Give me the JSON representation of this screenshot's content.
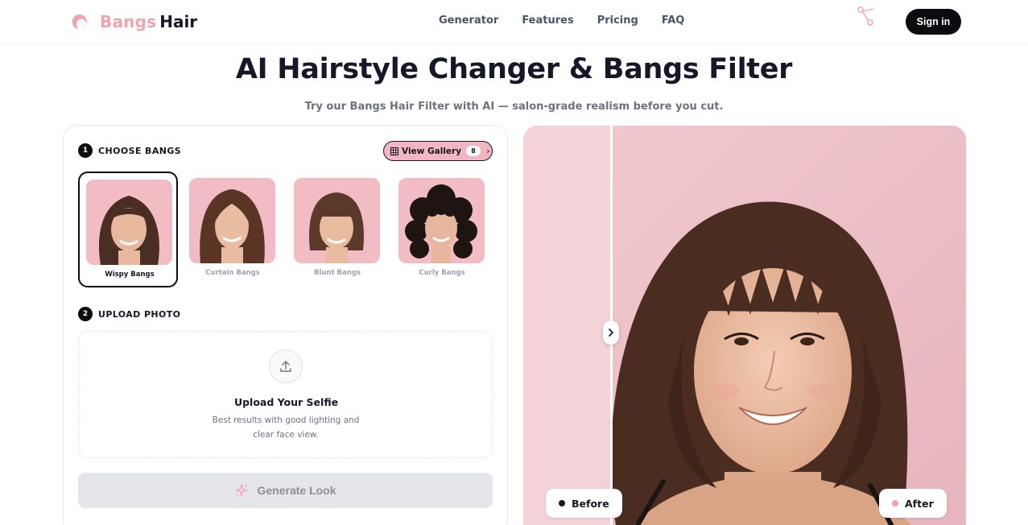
{
  "header": {
    "brand_part1": "Bangs",
    "brand_part2": "Hair",
    "nav": [
      "Generator",
      "Features",
      "Pricing",
      "FAQ"
    ],
    "decor_icon": "scissors-icon",
    "signin_label": "Sign in"
  },
  "hero": {
    "title": "AI Hairstyle Changer & Bangs Filter",
    "subtitle": "Try our Bangs Hair Filter with AI — salon-grade realism before you cut."
  },
  "choose": {
    "step_number": "1",
    "label": "CHOOSE BANGS",
    "gallery_label": "View Gallery",
    "gallery_count": "8",
    "styles": [
      {
        "name": "Wispy Bangs",
        "selected": true
      },
      {
        "name": "Curtain Bangs",
        "selected": false
      },
      {
        "name": "Blunt Bangs",
        "selected": false
      },
      {
        "name": "Curly Bangs",
        "selected": false
      }
    ]
  },
  "upload": {
    "step_number": "2",
    "label": "UPLOAD PHOTO",
    "title": "Upload Your Selfie",
    "description": "Best results with good lighting and clear face view."
  },
  "generate": {
    "label": "Generate Look"
  },
  "preview": {
    "before_label": "Before",
    "after_label": "After"
  },
  "colors": {
    "brand_pink": "#f0a3ae",
    "dark": "#141827",
    "preview_bg": "#efc1c8"
  }
}
